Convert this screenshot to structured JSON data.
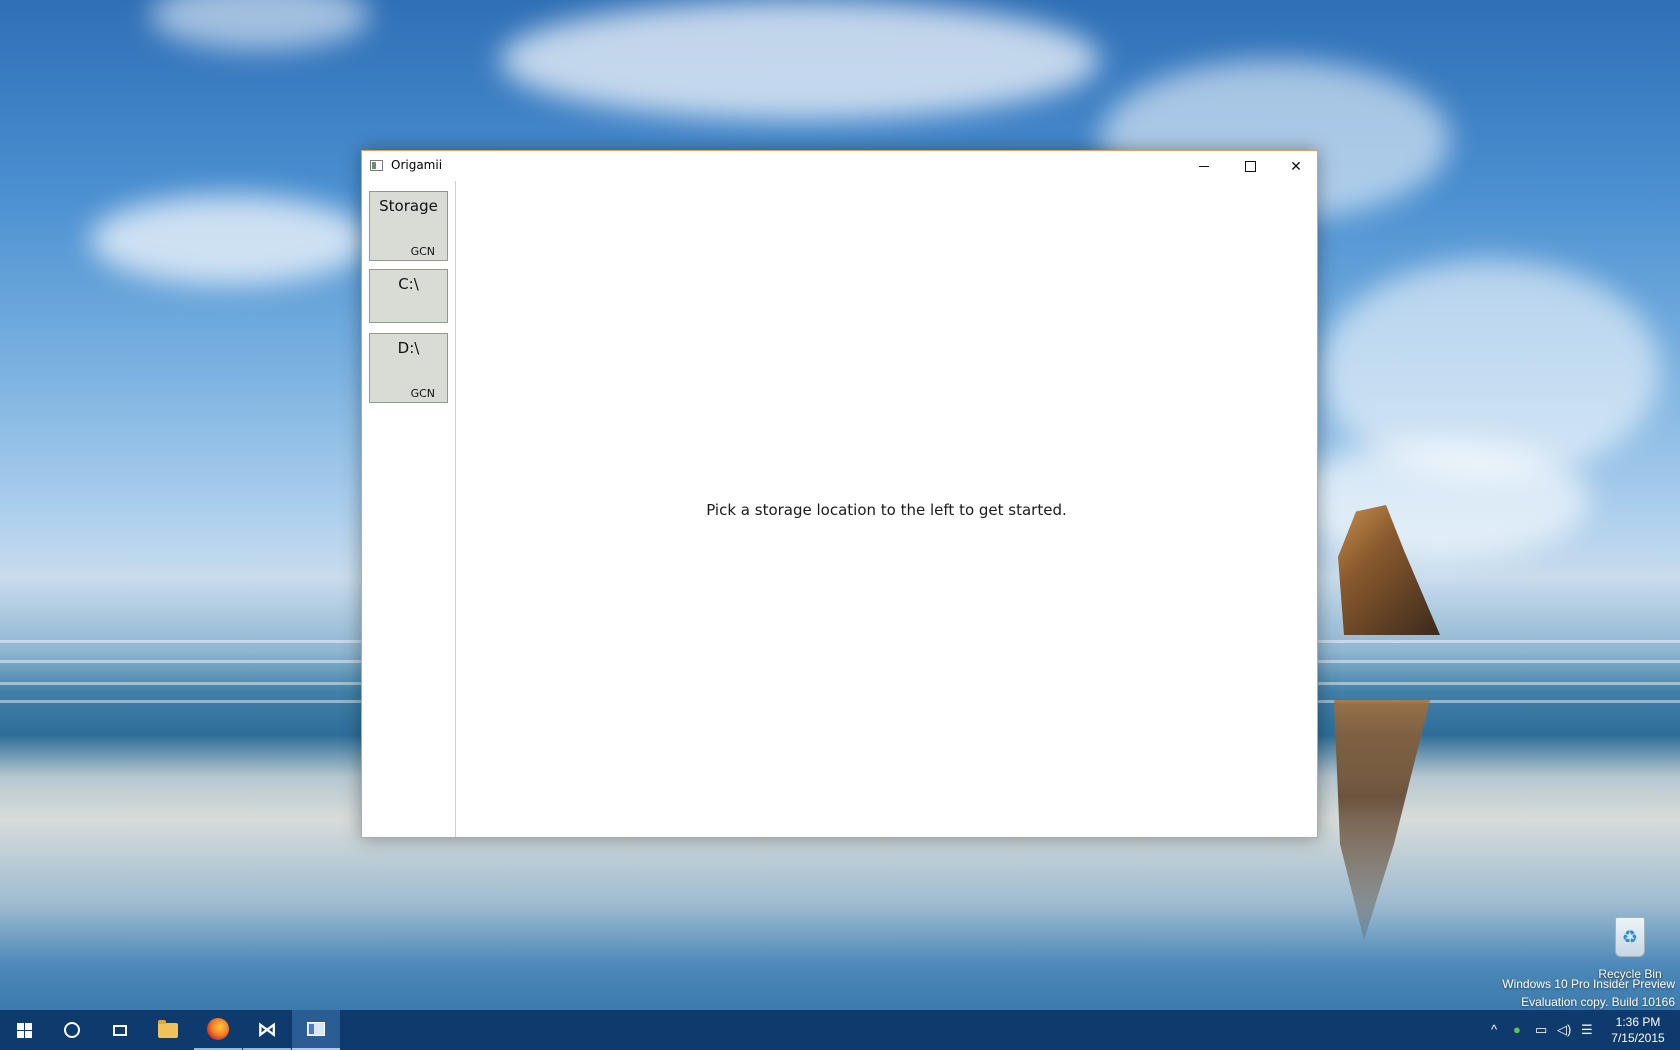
{
  "window": {
    "title": "Origamii",
    "minimize_label": "–",
    "maximize_label": "□",
    "close_label": "✕"
  },
  "sidebar": {
    "locations": [
      {
        "name": "Storage",
        "tag": "GCN"
      },
      {
        "name": "C:\\",
        "tag": ""
      },
      {
        "name": "D:\\",
        "tag": "GCN"
      }
    ]
  },
  "main": {
    "message": "Pick a storage location to the left to get started."
  },
  "desktop": {
    "recycle_bin_label": "Recycle Bin",
    "watermark_line1": "Windows 10 Pro Insider Preview",
    "watermark_line2": "Evaluation copy. Build 10166"
  },
  "taskbar": {
    "icons": [
      "windows-start-icon",
      "search-circle-icon",
      "task-view-icon",
      "file-explorer-icon",
      "firefox-icon",
      "visual-studio-icon",
      "origamii-app-icon"
    ],
    "tray": {
      "time": "1:36 PM",
      "date": "7/15/2015"
    }
  },
  "colors": {
    "window_border": "#e3a34c",
    "tile_background": "#d9dbd5",
    "taskbar": "#0f3a6e"
  }
}
